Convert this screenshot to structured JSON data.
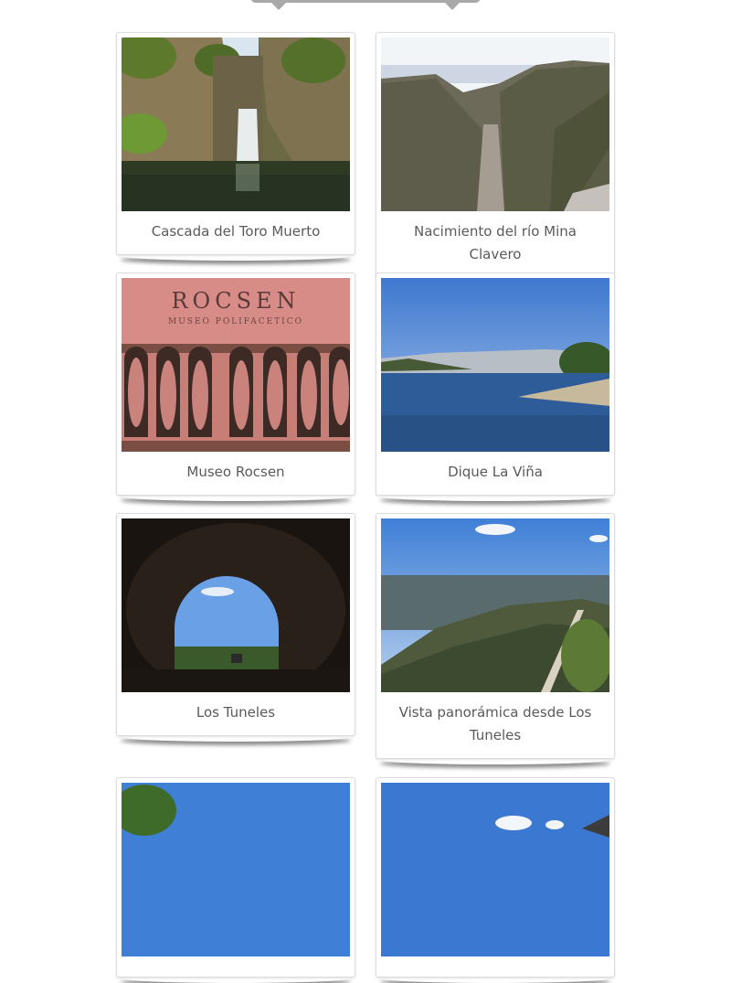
{
  "gallery": {
    "items": [
      {
        "caption": "Cascada del Toro Muerto",
        "image": "waterfall-photo"
      },
      {
        "caption": "Nacimiento del río Mina Clavero",
        "image": "river-gorge-photo"
      },
      {
        "caption": "Museo Rocsen",
        "image": "museum-facade-photo"
      },
      {
        "caption": "Dique La Viña",
        "image": "lake-dam-photo"
      },
      {
        "caption": "Los Tuneles",
        "image": "tunnel-photo"
      },
      {
        "caption": "Vista panorámica desde Los Tuneles",
        "image": "panoramic-valley-photo"
      },
      {
        "caption": "",
        "image": "landscape-photo"
      },
      {
        "caption": "",
        "image": "sky-landscape-photo"
      }
    ]
  },
  "sign": {
    "title": "ROCSEN",
    "subtitle": "MUSEO POLIFACETICO"
  }
}
